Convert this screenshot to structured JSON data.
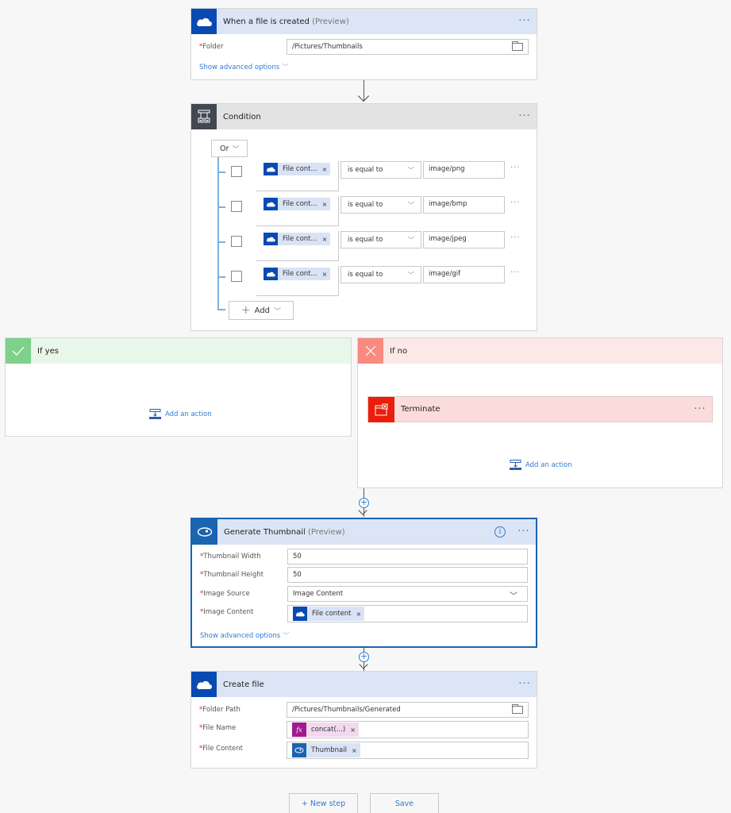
{
  "trigger": {
    "title": "When a file is created",
    "title_suffix": "(Preview)",
    "icon": "onedrive-cloud-icon",
    "more": "···",
    "fields": [
      {
        "label": "Folder",
        "required_mark": "*",
        "value": "/Pictures/Thumbnails"
      }
    ],
    "advanced_link": "Show advanced options",
    "advanced_chevron": "﹀"
  },
  "condition": {
    "title": "Condition",
    "icon": "condition-icon",
    "more": "···",
    "group_operator": "Or",
    "chevron": "﹀",
    "rows": [
      {
        "token": "File cont...",
        "token_x": "×",
        "operator": "is equal to",
        "value": "image/png",
        "more": "···"
      },
      {
        "token": "File cont...",
        "token_x": "×",
        "operator": "is equal to",
        "value": "image/bmp",
        "more": "···"
      },
      {
        "token": "File cont...",
        "token_x": "×",
        "operator": "is equal to",
        "value": "image/jpeg",
        "more": "···"
      },
      {
        "token": "File cont...",
        "token_x": "×",
        "operator": "is equal to",
        "value": "image/gif",
        "more": "···"
      }
    ],
    "add_button": {
      "plus": "+",
      "label": "Add",
      "chevron": "﹀"
    }
  },
  "if_yes": {
    "title": "If yes",
    "icon": "checkmark-icon",
    "add_action": "Add an action",
    "color": "#7ed08b"
  },
  "if_no": {
    "title": "If no",
    "icon": "close-icon",
    "color": "#f88a80",
    "actions": [
      {
        "title": "Terminate",
        "icon": "terminate-icon",
        "more": "···",
        "color": "#ea1e0b"
      }
    ],
    "add_action": "Add an action"
  },
  "generate_thumbnail": {
    "title": "Generate Thumbnail",
    "title_suffix": "(Preview)",
    "icon": "eye-icon",
    "info": "i",
    "more": "···",
    "fields": [
      {
        "label": "Thumbnail Width",
        "required_mark": "*",
        "value": "50"
      },
      {
        "label": "Thumbnail Height",
        "required_mark": "*",
        "value": "50"
      },
      {
        "label": "Image Source",
        "required_mark": "*",
        "value": "Image Content",
        "dropdown_chevron": "﹀"
      },
      {
        "label": "Image Content",
        "required_mark": "*",
        "token": "File content",
        "token_x": "×"
      }
    ],
    "advanced_link": "Show advanced options",
    "advanced_chevron": "﹀"
  },
  "create_file": {
    "title": "Create file",
    "icon": "onedrive-cloud-icon",
    "more": "···",
    "fields": [
      {
        "label": "Folder Path",
        "required_mark": "*",
        "value": "/Pictures/Thumbnails/Generated"
      },
      {
        "label": "File Name",
        "required_mark": "*",
        "token": "concat(...)",
        "token_icon": "fx",
        "token_x": "×"
      },
      {
        "label": "File Content",
        "required_mark": "*",
        "token": "Thumbnail",
        "token_x": "×"
      }
    ]
  },
  "connectors": {
    "plus": "+"
  },
  "footer": {
    "new_step": "+ New step",
    "save": "Save"
  },
  "colors": {
    "accent": "#2f7bd1",
    "onedrive": "#094ab2",
    "condition_icon": "#424852",
    "fx_token": "#a3198f"
  }
}
